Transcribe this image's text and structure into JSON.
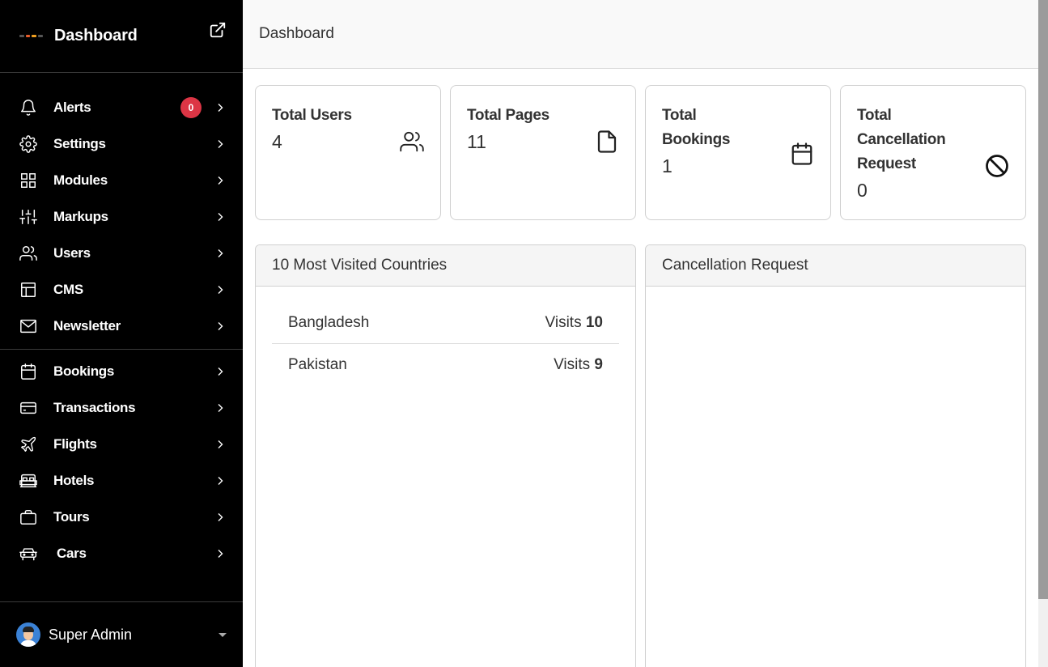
{
  "sidebar": {
    "brand_title": "Dashboard",
    "alerts_count": "0",
    "group1": [
      {
        "label": "Alerts",
        "icon": "bell-icon"
      },
      {
        "label": "Settings",
        "icon": "gear-icon"
      },
      {
        "label": "Modules",
        "icon": "grid-icon"
      },
      {
        "label": "Markups",
        "icon": "sliders-icon"
      },
      {
        "label": "Users",
        "icon": "users-icon"
      },
      {
        "label": "CMS",
        "icon": "layout-icon"
      },
      {
        "label": "Newsletter",
        "icon": "mail-icon"
      }
    ],
    "group2": [
      {
        "label": "Bookings",
        "icon": "calendar-icon"
      },
      {
        "label": "Transactions",
        "icon": "credit-card-icon"
      },
      {
        "label": "Flights",
        "icon": "airplane-icon"
      },
      {
        "label": "Hotels",
        "icon": "bed-icon"
      },
      {
        "label": "Tours",
        "icon": "briefcase-icon"
      },
      {
        "label": "Cars",
        "icon": "car-icon"
      }
    ],
    "user_name": "Super Admin"
  },
  "header": {
    "breadcrumb": "Dashboard"
  },
  "stats": [
    {
      "title": "Total Users",
      "value": "4",
      "icon": "users-icon"
    },
    {
      "title": "Total Pages",
      "value": "11",
      "icon": "file-icon"
    },
    {
      "title": "Total Bookings",
      "value": "1",
      "icon": "calendar-icon"
    },
    {
      "title": "Total Cancellation Request",
      "value": "0",
      "icon": "ban-icon"
    }
  ],
  "panels": {
    "countries_title": "10 Most Visited Countries",
    "cancellation_title": "Cancellation Request",
    "visits_label": "Visits",
    "countries": [
      {
        "name": "Bangladesh",
        "visits": "10"
      },
      {
        "name": "Pakistan",
        "visits": "9"
      }
    ]
  },
  "colors": {
    "sidebar_bg": "#000000",
    "badge": "#dc3545",
    "accent_avatar": "#3b82d6"
  }
}
